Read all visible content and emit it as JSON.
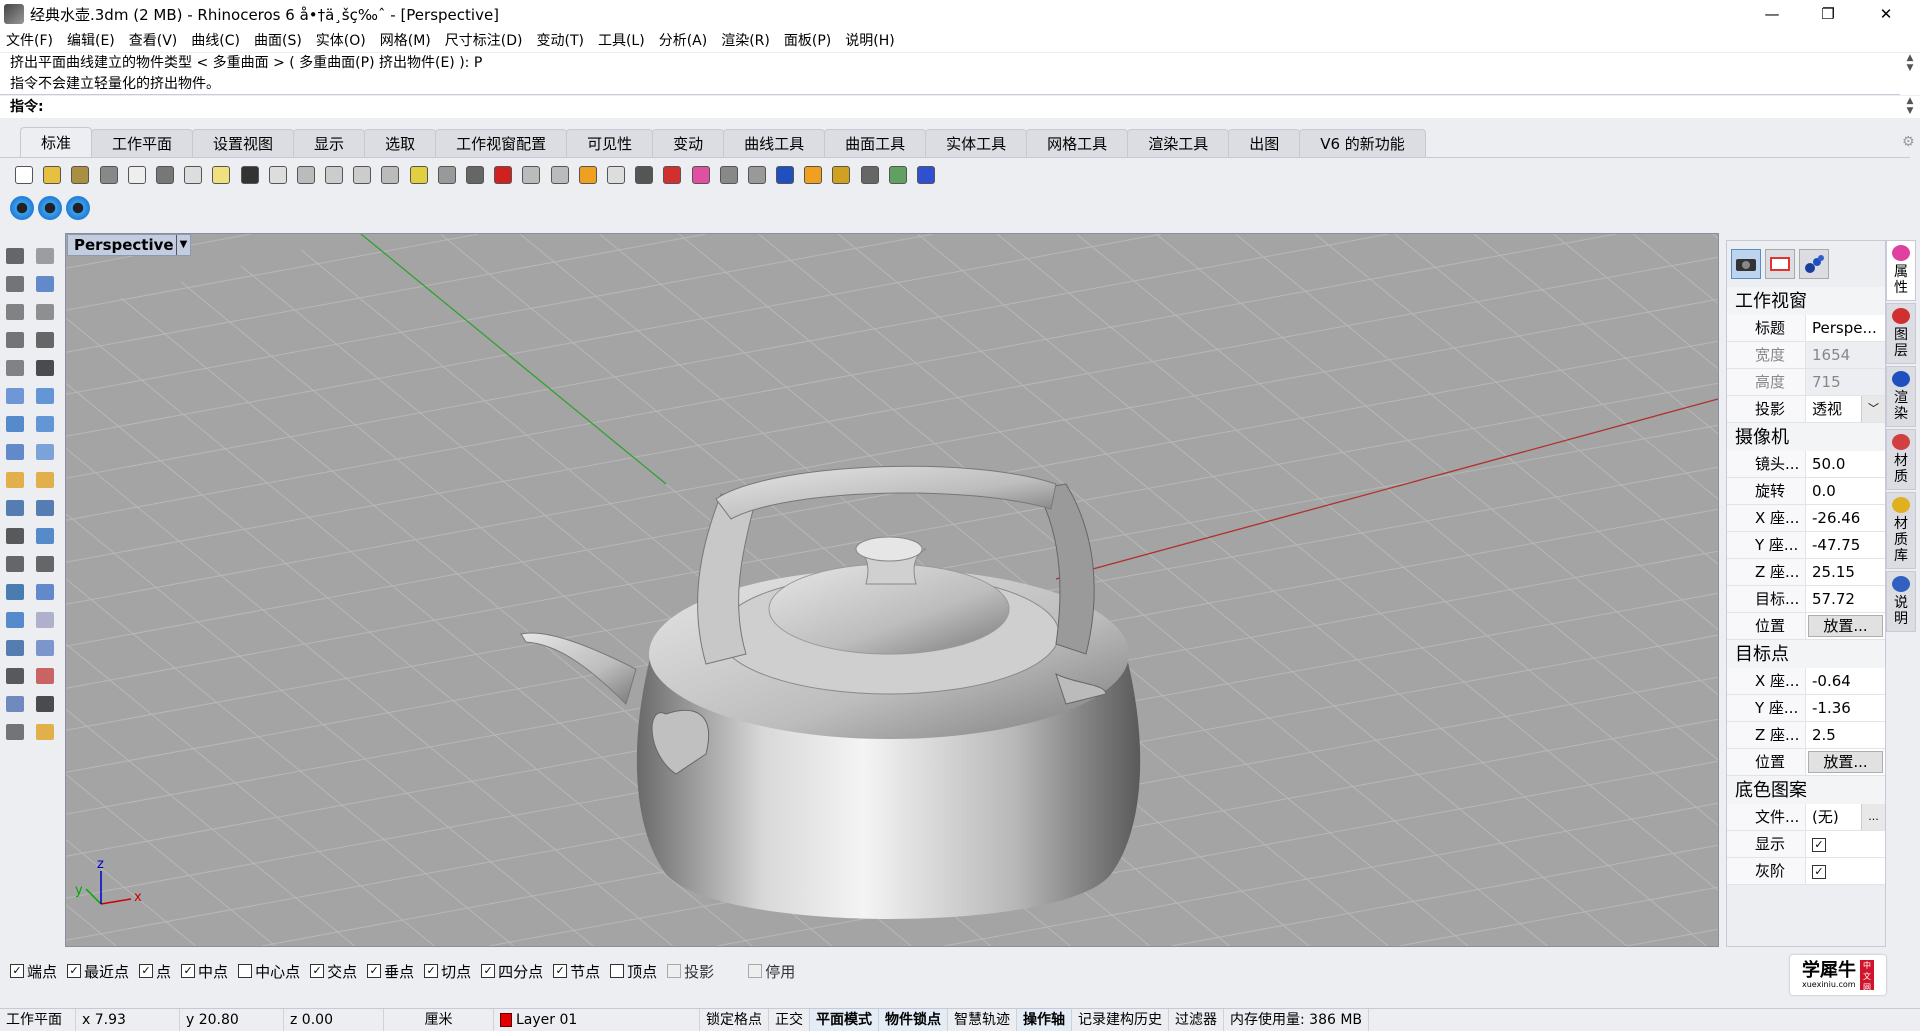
{
  "window": {
    "title": "经典水壶.3dm (2 MB) - Rhinoceros 6 å•†ä¸šç‰ˆ - [Perspective]",
    "minimize": "—",
    "restore": "❐",
    "close": "✕"
  },
  "menu": [
    "文件(F)",
    "编辑(E)",
    "查看(V)",
    "曲线(C)",
    "曲面(S)",
    "实体(O)",
    "网格(M)",
    "尺寸标注(D)",
    "变动(T)",
    "工具(L)",
    "分析(A)",
    "渲染(R)",
    "面板(P)",
    "说明(H)"
  ],
  "command": {
    "history": [
      "挤出平面曲线建立的物件类型 < 多重曲面 > ( 多重曲面(P)  挤出物件(E) ): P",
      "指令不会建立轻量化的挤出物件。"
    ],
    "prompt": "指令:"
  },
  "tabs": [
    "标准",
    "工作平面",
    "设置视图",
    "显示",
    "选取",
    "工作视窗配置",
    "可见性",
    "变动",
    "曲线工具",
    "曲面工具",
    "实体工具",
    "网格工具",
    "渲染工具",
    "出图",
    "V6 的新功能"
  ],
  "active_tab": 0,
  "toolbar_icons": [
    "new-file",
    "open-folder",
    "save",
    "print",
    "import",
    "cut",
    "copy",
    "paste",
    "undo",
    "pan-hand",
    "rotate-view",
    "zoom-in",
    "zoom-window",
    "zoom-extents",
    "zoom-selected",
    "undo-view",
    "four-viewports",
    "car-named-view",
    "cplane-grid",
    "circle-point",
    "object-properties",
    "light-bulb",
    "lock",
    "layer-stack",
    "color-wheel",
    "shaded-sphere",
    "rendered-sphere",
    "render-blue-sphere",
    "cone-highlight",
    "gear-options",
    "dimension",
    "grasshopper",
    "help"
  ],
  "toolbar_colors": [
    "#fff",
    "#e8c040",
    "#a89040",
    "#888",
    "#eee",
    "#777",
    "#ddd",
    "#f0e080",
    "#333",
    "#ddd",
    "#bbb",
    "#ccc",
    "#ccc",
    "#bbb",
    "#e0d040",
    "#999",
    "#666",
    "#d02020",
    "#bbb",
    "#bbb",
    "#f0a020",
    "#ddd",
    "#555",
    "#d03030",
    "#e050a0",
    "#888",
    "#999",
    "#2050c0",
    "#f0a020",
    "#d0a020",
    "#666",
    "#60a060",
    "#3050d0"
  ],
  "toolbar2_icons": [
    "viewport-icon-1",
    "viewport-icon-2",
    "viewport-icon-3"
  ],
  "left_icon_colors": [
    "#444",
    "#888",
    "#555",
    "#4070c0",
    "#666",
    "#777",
    "#555",
    "#444",
    "#666",
    "#222",
    "#5080d0",
    "#4080d0",
    "#3070c0",
    "#4080d0",
    "#4070c0",
    "#6090d0",
    "#e0a020",
    "#e0a020",
    "#3060a0",
    "#3060a0",
    "#333",
    "#3070c0",
    "#444",
    "#444",
    "#2060a0",
    "#4070c0",
    "#3070c0",
    "#a0a0c0",
    "#3060a0",
    "#6080c0",
    "#333",
    "#c04040",
    "#5070b0",
    "#222",
    "#555",
    "#e0a020"
  ],
  "viewport": {
    "label": "Perspective",
    "axis_x": "x",
    "axis_y": "y",
    "axis_z": "z"
  },
  "properties": {
    "sections": [
      {
        "title": "工作视窗",
        "rows": [
          {
            "k": "标题",
            "v": "Perspe..."
          },
          {
            "k": "宽度",
            "v": "1654",
            "disabled": true
          },
          {
            "k": "高度",
            "v": "715",
            "disabled": true
          },
          {
            "k": "投影",
            "v": "透视",
            "dropdown": true
          }
        ]
      },
      {
        "title": "摄像机",
        "rows": [
          {
            "k": "镜头...",
            "v": "50.0"
          },
          {
            "k": "旋转",
            "v": "0.0"
          },
          {
            "k": "X 座...",
            "v": "-26.46"
          },
          {
            "k": "Y 座...",
            "v": "-47.75"
          },
          {
            "k": "Z 座...",
            "v": "25.15"
          },
          {
            "k": "目标...",
            "v": "57.72"
          },
          {
            "k": "位置",
            "button": "放置..."
          }
        ]
      },
      {
        "title": "目标点",
        "rows": [
          {
            "k": "X 座...",
            "v": "-0.64"
          },
          {
            "k": "Y 座...",
            "v": "-1.36"
          },
          {
            "k": "Z 座...",
            "v": "2.5"
          },
          {
            "k": "位置",
            "button": "放置..."
          }
        ]
      },
      {
        "title": "底色图案",
        "rows": [
          {
            "k": "文件...",
            "v": "(无)",
            "browse": "..."
          },
          {
            "k": "显示",
            "check": true
          },
          {
            "k": "灰阶",
            "check": true
          }
        ]
      }
    ]
  },
  "side_tabs": [
    {
      "label": "属性",
      "color": "#e040a0"
    },
    {
      "label": "图层",
      "color": "#d03030"
    },
    {
      "label": "渲染",
      "color": "#2050c0"
    },
    {
      "label": "材质",
      "color": "#d04040"
    },
    {
      "label": "材质库",
      "color": "#e0b020"
    },
    {
      "label": "说明",
      "color": "#3060c0"
    }
  ],
  "osnaps": [
    {
      "label": "端点",
      "checked": true
    },
    {
      "label": "最近点",
      "checked": true
    },
    {
      "label": "点",
      "checked": true
    },
    {
      "label": "中点",
      "checked": true
    },
    {
      "label": "中心点",
      "checked": false
    },
    {
      "label": "交点",
      "checked": true
    },
    {
      "label": "垂点",
      "checked": true
    },
    {
      "label": "切点",
      "checked": true
    },
    {
      "label": "四分点",
      "checked": true
    },
    {
      "label": "节点",
      "checked": true
    },
    {
      "label": "顶点",
      "checked": false
    },
    {
      "label": "投影",
      "checked": false,
      "disabled": true
    },
    {
      "label": "停用",
      "checked": false,
      "disabled": true
    }
  ],
  "brand": {
    "name": "学犀牛",
    "url": "xuexiniu.com",
    "tag": "中文网"
  },
  "status": {
    "cplane": "工作平面",
    "x": "x 7.93",
    "y": "y 20.80",
    "z": "z 0.00",
    "units": "厘米",
    "layer": "Layer 01",
    "layer_color": "#e00000",
    "toggles": [
      {
        "label": "锁定格点",
        "on": false
      },
      {
        "label": "正交",
        "on": false
      },
      {
        "label": "平面模式",
        "on": true
      },
      {
        "label": "物件锁点",
        "on": true
      },
      {
        "label": "智慧轨迹",
        "on": false
      },
      {
        "label": "操作轴",
        "on": true
      },
      {
        "label": "记录建构历史",
        "on": false
      },
      {
        "label": "过滤器",
        "on": false
      }
    ],
    "memory": "内存使用量: 386 MB"
  }
}
